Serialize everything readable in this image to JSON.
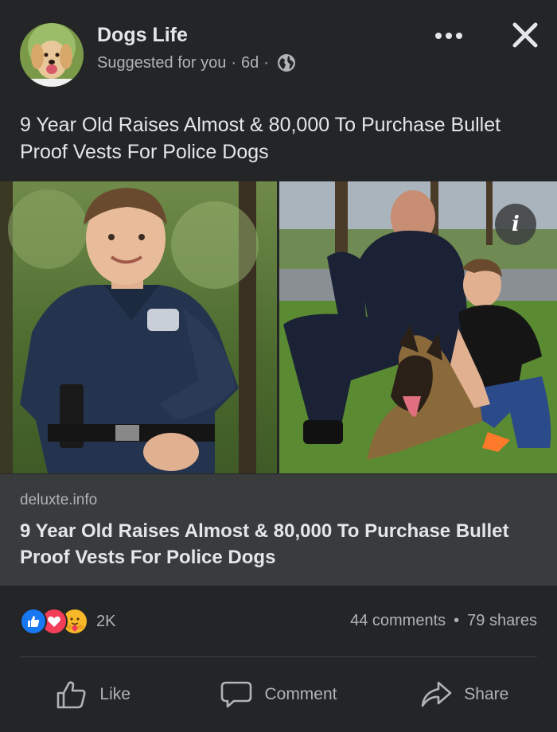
{
  "post": {
    "page_name": "Dogs Life",
    "suggested": "Suggested for you",
    "separator": "·",
    "time": "6d",
    "caption": "9 Year Old Raises Almost & 80,000 To Purchase Bullet Proof Vests For Police Dogs",
    "icons": {
      "more": "more-options-icon",
      "close": "close-icon",
      "audience": "globe-icon",
      "info": "info-icon"
    },
    "info_glyph": "i"
  },
  "link_preview": {
    "domain": "deluxte.info",
    "title": "9 Year Old Raises Almost & 80,000 To Purchase Bullet Proof Vests For Police Dogs"
  },
  "reactions": {
    "types": [
      "like",
      "love",
      "care"
    ],
    "count": "2K",
    "comments": "44 comments",
    "shares": "79 shares",
    "dot": "•"
  },
  "actions": {
    "like": "Like",
    "comment": "Comment",
    "share": "Share"
  },
  "colors": {
    "background": "#242526",
    "link_box": "#3a3b3c",
    "primary_text": "#e4e6eb",
    "secondary_text": "#b0b3b8",
    "like_blue": "#1877f2",
    "love_red": "#f33e58",
    "care_yellow": "#f7b928"
  }
}
